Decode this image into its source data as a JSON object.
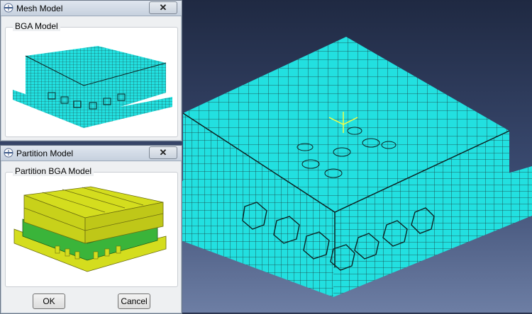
{
  "mesh_dialog": {
    "title": "Mesh Model",
    "group_label": "BGA Model",
    "close_icon": "close-icon"
  },
  "partition_dialog": {
    "title": "Partition Model",
    "group_label": "Partition BGA Model",
    "close_icon": "close-icon",
    "ok_label": "OK",
    "cancel_label": "Cancel"
  },
  "colors": {
    "mesh_fill": "#22e0e0",
    "mesh_lines": "#1a3b3b",
    "partition_yellow": "#d4dd1e",
    "partition_green": "#3ab43a",
    "viewport_background": "#2b3550",
    "dialog_background": "#eef0f2"
  },
  "icons": {
    "dialog_icon": "crosshair-icon",
    "triad": "coordinate-triad-icon"
  }
}
